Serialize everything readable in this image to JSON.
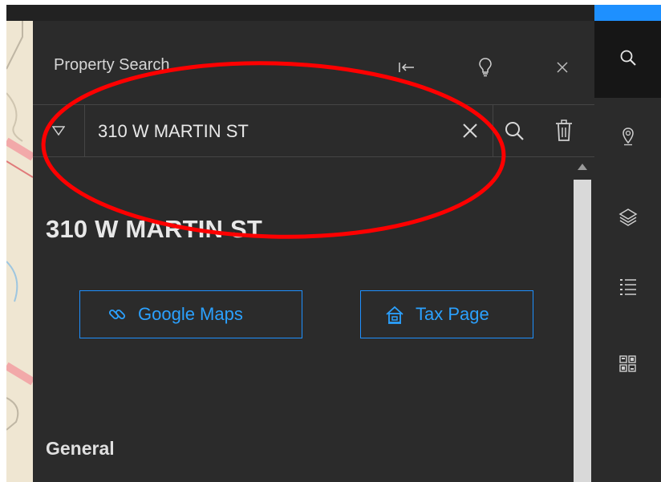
{
  "panel": {
    "title": "Property Search",
    "collapse_icon": "collapse-left-icon",
    "tip_icon": "lightbulb-icon",
    "close_icon": "close-icon"
  },
  "search": {
    "value": "310 W MARTIN ST",
    "dropdown_icon": "filter-dropdown-icon",
    "clear_icon": "clear-icon",
    "search_icon": "search-icon",
    "trash_icon": "trash-icon"
  },
  "result": {
    "title": "310 W MARTIN ST",
    "links": [
      {
        "label": "Google Maps",
        "icon": "link-icon"
      },
      {
        "label": "Tax Page",
        "icon": "home-icon"
      }
    ],
    "section": "General"
  },
  "rail": {
    "items": [
      {
        "name": "search",
        "icon": "search-icon",
        "active": true
      },
      {
        "name": "location",
        "icon": "map-pin-icon",
        "active": false
      },
      {
        "name": "layers",
        "icon": "layers-icon",
        "active": false
      },
      {
        "name": "legend",
        "icon": "list-icon",
        "active": false
      },
      {
        "name": "basemap",
        "icon": "grid-icon",
        "active": false
      }
    ]
  },
  "colors": {
    "accent": "#1e90ff",
    "panel_bg": "#2b2b2b",
    "annotation": "#ff0000"
  }
}
